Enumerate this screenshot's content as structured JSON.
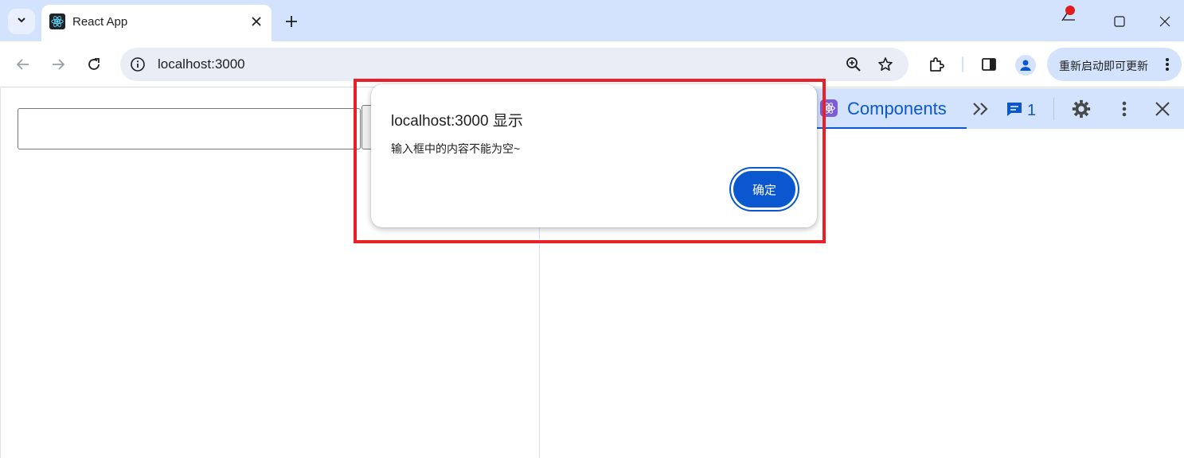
{
  "browser": {
    "tab": {
      "title": "React App",
      "favicon": "react-logo-icon"
    },
    "new_tab_icon": "plus-icon",
    "window_controls": [
      "minimize-icon",
      "maximize-icon",
      "close-icon"
    ],
    "address": {
      "url": "localhost:3000",
      "info_icon": "site-info-icon",
      "zoom_icon": "zoom-in-icon",
      "bookmark_icon": "star-icon"
    },
    "toolbar": {
      "extensions_icon": "puzzle-icon",
      "sidepanel_icon": "side-panel-icon",
      "profile_icon": "person-icon",
      "update_label": "重新启动即可更新",
      "menu_icon": "kebab-menu-icon"
    }
  },
  "page": {
    "input_value": "",
    "button_label": ""
  },
  "devtools": {
    "active_tab": "Components",
    "more_tabs_icon": "double-chevron-right-icon",
    "issues_icon": "message-icon",
    "issues_count": "1",
    "settings_icon": "gear-icon",
    "menu_icon": "kebab-menu-icon",
    "close_icon": "close-icon"
  },
  "alert": {
    "title": "localhost:3000 显示",
    "message": "输入框中的内容不能为空~",
    "ok_label": "确定"
  },
  "colors": {
    "chrome_bg": "#d3e3fd",
    "accent": "#0b57d0",
    "highlight": "#e8202a"
  }
}
